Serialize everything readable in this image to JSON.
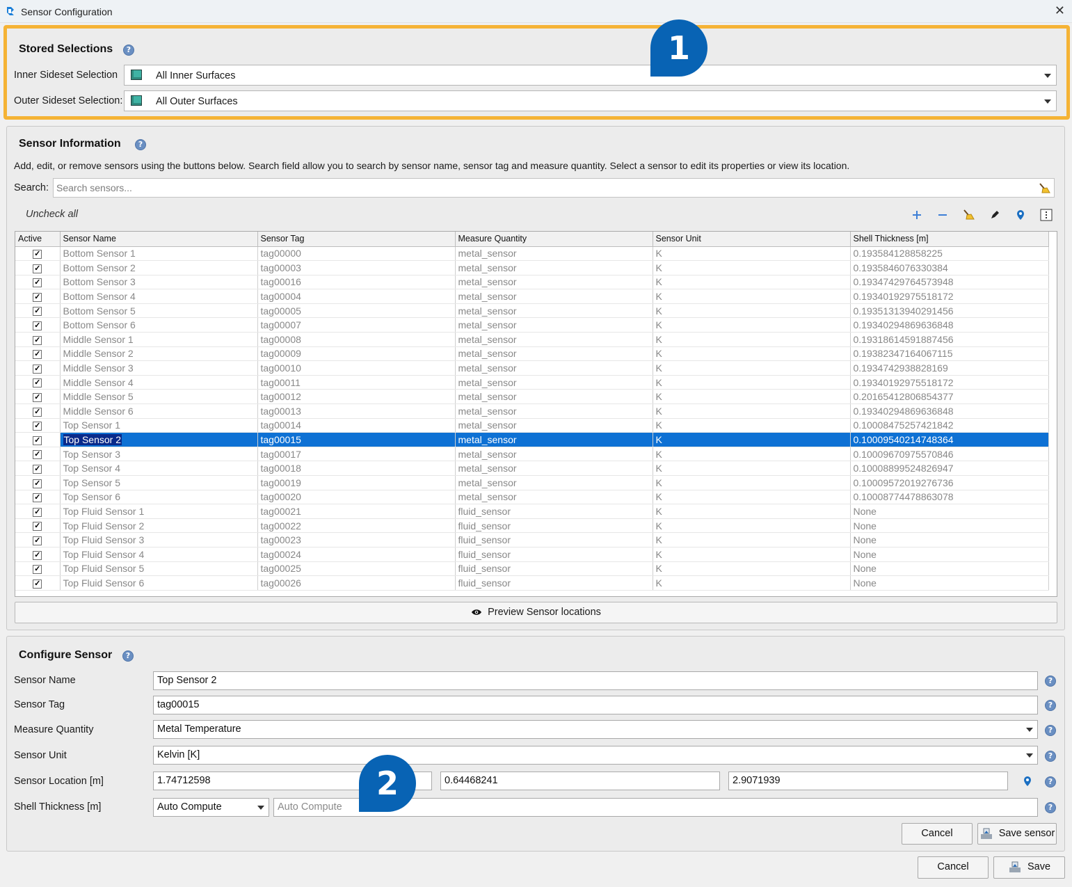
{
  "window": {
    "title": "Sensor Configuration",
    "close": "✕"
  },
  "stored": {
    "title": "Stored Selections",
    "inner_label": "Inner Sideset Selection",
    "inner_value": "All Inner Surfaces",
    "outer_label": "Outer Sideset Selection:",
    "outer_value": "All Outer Surfaces"
  },
  "info": {
    "title": "Sensor Information",
    "description": "Add, edit, or remove sensors using the buttons below. Search field allow you to search by sensor name, sensor tag and measure quantity. Select a sensor to edit its properties or view its location.",
    "search_label": "Search:",
    "search_placeholder": "Search sensors...",
    "uncheck_all": "Uncheck all",
    "columns": [
      "Active",
      "Sensor Name",
      "Sensor Tag",
      "Measure Quantity",
      "Sensor Unit",
      "Shell Thickness [m]"
    ],
    "check_mark": "✓",
    "rows": [
      {
        "name": "Bottom Sensor 1",
        "tag": "tag00000",
        "quantity": "metal_sensor",
        "unit": "K",
        "thickness": "0.193584128858225"
      },
      {
        "name": "Bottom Sensor 2",
        "tag": "tag00003",
        "quantity": "metal_sensor",
        "unit": "K",
        "thickness": "0.1935846076330384"
      },
      {
        "name": "Bottom Sensor 3",
        "tag": "tag00016",
        "quantity": "metal_sensor",
        "unit": "K",
        "thickness": "0.19347429764573948"
      },
      {
        "name": "Bottom Sensor 4",
        "tag": "tag00004",
        "quantity": "metal_sensor",
        "unit": "K",
        "thickness": "0.19340192975518172"
      },
      {
        "name": "Bottom Sensor 5",
        "tag": "tag00005",
        "quantity": "metal_sensor",
        "unit": "K",
        "thickness": "0.19351313940291456"
      },
      {
        "name": "Bottom Sensor 6",
        "tag": "tag00007",
        "quantity": "metal_sensor",
        "unit": "K",
        "thickness": "0.19340294869636848"
      },
      {
        "name": "Middle Sensor 1",
        "tag": "tag00008",
        "quantity": "metal_sensor",
        "unit": "K",
        "thickness": "0.19318614591887456"
      },
      {
        "name": "Middle Sensor 2",
        "tag": "tag00009",
        "quantity": "metal_sensor",
        "unit": "K",
        "thickness": "0.19382347164067115"
      },
      {
        "name": "Middle Sensor 3",
        "tag": "tag00010",
        "quantity": "metal_sensor",
        "unit": "K",
        "thickness": "0.1934742938828169"
      },
      {
        "name": "Middle Sensor 4",
        "tag": "tag00011",
        "quantity": "metal_sensor",
        "unit": "K",
        "thickness": "0.19340192975518172"
      },
      {
        "name": "Middle Sensor 5",
        "tag": "tag00012",
        "quantity": "metal_sensor",
        "unit": "K",
        "thickness": "0.20165412806854377"
      },
      {
        "name": "Middle Sensor 6",
        "tag": "tag00013",
        "quantity": "metal_sensor",
        "unit": "K",
        "thickness": "0.19340294869636848"
      },
      {
        "name": "Top Sensor 1",
        "tag": "tag00014",
        "quantity": "metal_sensor",
        "unit": "K",
        "thickness": "0.10008475257421842"
      },
      {
        "name": "Top Sensor 2",
        "tag": "tag00015",
        "quantity": "metal_sensor",
        "unit": "K",
        "thickness": "0.10009540214748364",
        "selected": true
      },
      {
        "name": "Top Sensor 3",
        "tag": "tag00017",
        "quantity": "metal_sensor",
        "unit": "K",
        "thickness": "0.10009670975570846"
      },
      {
        "name": "Top Sensor 4",
        "tag": "tag00018",
        "quantity": "metal_sensor",
        "unit": "K",
        "thickness": "0.10008899524826947"
      },
      {
        "name": "Top Sensor 5",
        "tag": "tag00019",
        "quantity": "metal_sensor",
        "unit": "K",
        "thickness": "0.10009572019276736"
      },
      {
        "name": "Top Sensor 6",
        "tag": "tag00020",
        "quantity": "metal_sensor",
        "unit": "K",
        "thickness": "0.10008774478863078"
      },
      {
        "name": "Top Fluid Sensor 1",
        "tag": "tag00021",
        "quantity": "fluid_sensor",
        "unit": "K",
        "thickness": "None"
      },
      {
        "name": "Top Fluid Sensor 2",
        "tag": "tag00022",
        "quantity": "fluid_sensor",
        "unit": "K",
        "thickness": "None"
      },
      {
        "name": "Top Fluid Sensor 3",
        "tag": "tag00023",
        "quantity": "fluid_sensor",
        "unit": "K",
        "thickness": "None"
      },
      {
        "name": "Top Fluid Sensor 4",
        "tag": "tag00024",
        "quantity": "fluid_sensor",
        "unit": "K",
        "thickness": "None"
      },
      {
        "name": "Top Fluid Sensor 5",
        "tag": "tag00025",
        "quantity": "fluid_sensor",
        "unit": "K",
        "thickness": "None"
      },
      {
        "name": "Top Fluid Sensor 6",
        "tag": "tag00026",
        "quantity": "fluid_sensor",
        "unit": "K",
        "thickness": "None"
      }
    ],
    "preview_label": "Preview Sensor locations"
  },
  "configure": {
    "title": "Configure Sensor",
    "name_label": "Sensor Name",
    "name_value": "Top Sensor 2",
    "tag_label": "Sensor Tag",
    "tag_value": "tag00015",
    "quantity_label": "Measure Quantity",
    "quantity_value": "Metal Temperature",
    "unit_label": "Sensor Unit",
    "unit_value": "Kelvin [K]",
    "location_label": "Sensor Location [m]",
    "loc_x": "1.74712598",
    "loc_y": "0.64468241",
    "loc_z": "2.9071939",
    "thickness_label": "Shell Thickness [m]",
    "thickness_mode": "Auto Compute",
    "thickness_value": "Auto Compute",
    "cancel_label": "Cancel",
    "save_sensor_label": "Save sensor"
  },
  "footer": {
    "cancel_label": "Cancel",
    "save_label": "Save"
  },
  "annotations": {
    "badge1": "1",
    "badge2": "2"
  },
  "help_mark": "?",
  "colors": {
    "highlight": "#f5b335",
    "selection": "#0e71d4",
    "badge": "#0863b4",
    "icon_blue": "#1b6fc2"
  },
  "icons": [
    "app-icon",
    "close-icon",
    "help-icon",
    "cube-icon",
    "dropdown-arrow-icon",
    "broom-icon",
    "plus-icon",
    "minus-icon",
    "pencil-icon",
    "location-pin-icon",
    "columns-icon",
    "eye-icon",
    "save-icon"
  ]
}
